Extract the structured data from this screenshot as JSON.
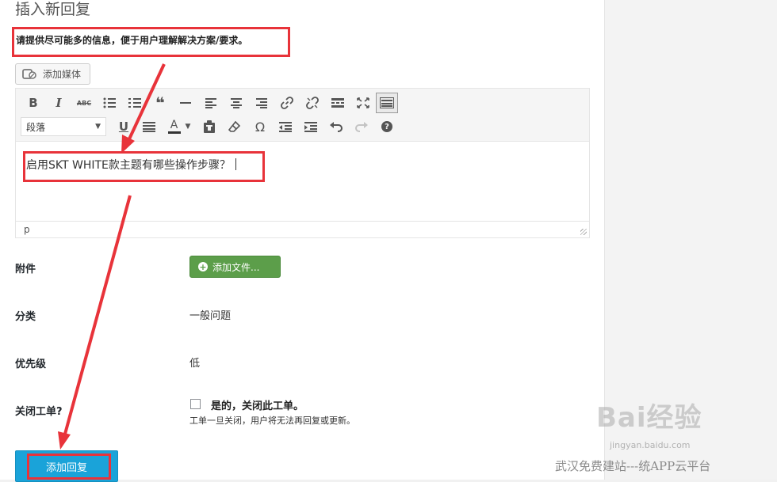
{
  "page": {
    "title": "插入新回复",
    "hint": "请提供尽可能多的信息，便于用户理解解决方案/要求。",
    "highlight_color": "#e8333a"
  },
  "media_button": {
    "label": "添加媒体",
    "icon": "add-media-icon"
  },
  "editor": {
    "format_select": "段落",
    "content": "启用SKT WHITE款主题有哪些操作步骤？",
    "status_path": "p",
    "toolbar_row1": [
      "bold",
      "italic",
      "strikethrough",
      "bullet-list",
      "numbered-list",
      "blockquote",
      "horizontal-rule",
      "align-left",
      "align-center",
      "align-right",
      "insert-link",
      "remove-link",
      "read-more",
      "fullscreen",
      "toolbar-toggle"
    ],
    "toolbar_row2": [
      "underline",
      "justify",
      "text-color",
      "paste-as-text",
      "clear-formatting",
      "special-character",
      "outdent",
      "indent",
      "undo",
      "redo",
      "help"
    ],
    "bold_glyph": "B",
    "italic_glyph": "I",
    "strike_glyph": "ABC",
    "underline_glyph": "U",
    "color_glyph": "A",
    "omega_glyph": "Ω",
    "quote_glyph": "❝",
    "help_glyph": "?"
  },
  "form": {
    "attachment": {
      "label": "附件",
      "button": "添加文件..."
    },
    "category": {
      "label": "分类",
      "value": "一般问题"
    },
    "priority": {
      "label": "优先级",
      "value": "低"
    },
    "close_ticket": {
      "label": "关闭工单?",
      "option": "是的，关闭此工单。",
      "description": "工单一旦关闭，用户将无法再回复或更新。",
      "checked": false
    }
  },
  "submit": {
    "label": "添加回复",
    "color": "#1aa3d9"
  },
  "watermark": {
    "logo": "Bai经验",
    "url": "jingyan.baidu.com",
    "caption": "武汉免费建站---统APP云平台"
  }
}
